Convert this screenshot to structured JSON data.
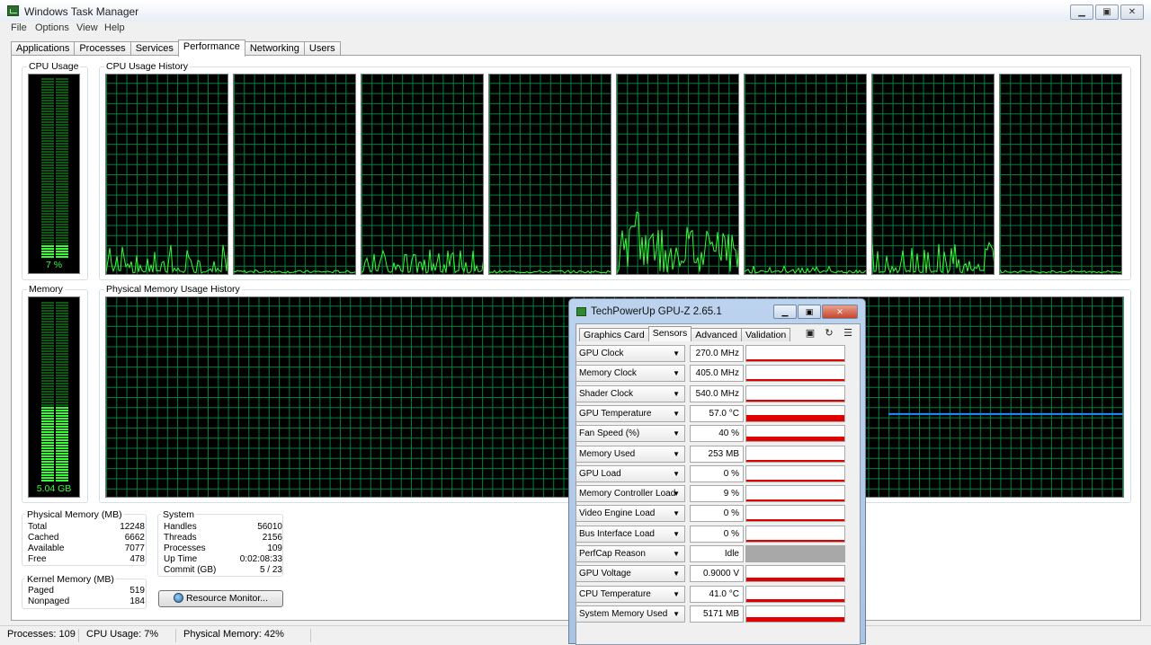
{
  "window": {
    "title": "Windows Task Manager",
    "minimize": "▁",
    "maximize": "▣",
    "close": "✕"
  },
  "menu": [
    {
      "label": "File"
    },
    {
      "label": "Options"
    },
    {
      "label": "View"
    },
    {
      "label": "Help"
    }
  ],
  "tabs": [
    {
      "label": "Applications"
    },
    {
      "label": "Processes"
    },
    {
      "label": "Services"
    },
    {
      "label": "Performance",
      "active": true
    },
    {
      "label": "Networking"
    },
    {
      "label": "Users"
    }
  ],
  "cpu": {
    "label": "CPU Usage",
    "value": "7 %",
    "level": 0.07,
    "history_label": "CPU Usage History"
  },
  "memory": {
    "label": "Memory",
    "value": "5.04 GB",
    "level": 0.42,
    "history_label": "Physical Memory Usage History"
  },
  "physical_memory": {
    "title": "Physical Memory (MB)",
    "rows": [
      {
        "label": "Total",
        "value": "12248"
      },
      {
        "label": "Cached",
        "value": "6662"
      },
      {
        "label": "Available",
        "value": "7077"
      },
      {
        "label": "Free",
        "value": "478"
      }
    ]
  },
  "kernel_memory": {
    "title": "Kernel Memory (MB)",
    "rows": [
      {
        "label": "Paged",
        "value": "519"
      },
      {
        "label": "Nonpaged",
        "value": "184"
      }
    ]
  },
  "system": {
    "title": "System",
    "rows": [
      {
        "label": "Handles",
        "value": "56010"
      },
      {
        "label": "Threads",
        "value": "2156"
      },
      {
        "label": "Processes",
        "value": "109"
      },
      {
        "label": "Up Time",
        "value": "0:02:08:33"
      },
      {
        "label": "Commit (GB)",
        "value": "5 / 23"
      }
    ]
  },
  "resource_monitor_button": "Resource Monitor...",
  "status_bar": {
    "processes": "Processes: 109",
    "cpu_usage": "CPU Usage: 7%",
    "physical_memory": "Physical Memory: 42%"
  },
  "colors": {
    "graph_green": "#33ff33",
    "grid": "#008040",
    "memory_line": "#1f8fff",
    "sensor_bar": "#e00000"
  },
  "gpuz": {
    "title": "TechPowerUp GPU-Z 2.65.1",
    "tabs": [
      {
        "label": "Graphics Card"
      },
      {
        "label": "Sensors",
        "active": true
      },
      {
        "label": "Advanced"
      },
      {
        "label": "Validation"
      }
    ],
    "toolbar": [
      {
        "icon": "camera-icon"
      },
      {
        "icon": "refresh-icon"
      },
      {
        "icon": "menu-icon"
      }
    ],
    "sensors": [
      {
        "name": "GPU Clock",
        "value": "270.0 MHz",
        "level": 0.12,
        "color": "#e00000"
      },
      {
        "name": "Memory Clock",
        "value": "405.0 MHz",
        "level": 0.12,
        "color": "#e00000"
      },
      {
        "name": "Shader Clock",
        "value": "540.0 MHz",
        "level": 0.12,
        "color": "#e00000"
      },
      {
        "name": "GPU Temperature",
        "value": "57.0 °C",
        "level": 0.4,
        "color": "#e00000"
      },
      {
        "name": "Fan Speed (%)",
        "value": "40 %",
        "level": 0.3,
        "color": "#e00000"
      },
      {
        "name": "Memory Used",
        "value": "253 MB",
        "level": 0.14,
        "color": "#e00000"
      },
      {
        "name": "GPU Load",
        "value": "0 %",
        "level": 0.0,
        "color": "#e00000"
      },
      {
        "name": "Memory Controller Load",
        "value": "9 %",
        "level": 0.08,
        "color": "#e00000"
      },
      {
        "name": "Video Engine Load",
        "value": "0 %",
        "level": 0.0,
        "color": "#e00000"
      },
      {
        "name": "Bus Interface Load",
        "value": "0 %",
        "level": 0.0,
        "color": "#e00000"
      },
      {
        "name": "PerfCap Reason",
        "value": "Idle",
        "level": 1.0,
        "color": "#a8a8a8"
      },
      {
        "name": "GPU Voltage",
        "value": "0.9000 V",
        "level": 0.25,
        "color": "#e00000"
      },
      {
        "name": "CPU Temperature",
        "value": "41.0 °C",
        "level": 0.18,
        "color": "#e00000"
      },
      {
        "name": "System Memory Used",
        "value": "5171 MB",
        "level": 0.32,
        "color": "#e00000"
      }
    ]
  }
}
